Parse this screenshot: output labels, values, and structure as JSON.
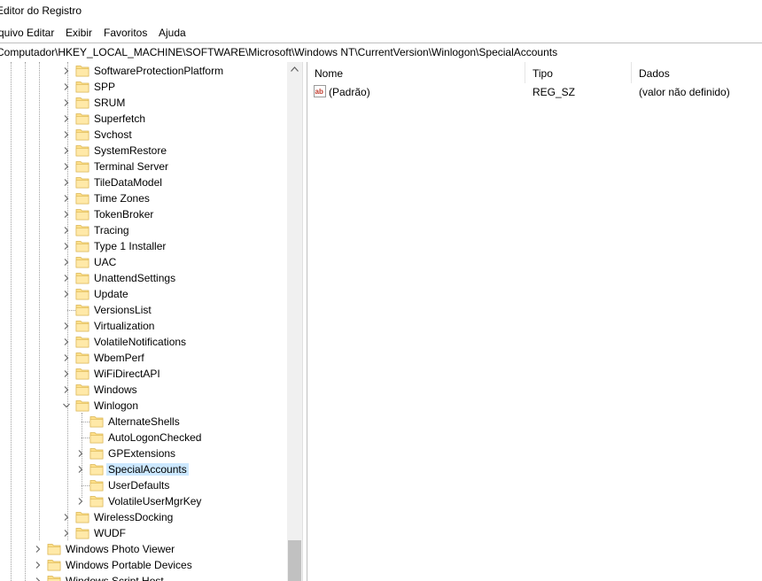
{
  "window": {
    "title": "Editor do Registro"
  },
  "menu": [
    "Arquivo",
    "Editar",
    "Exibir",
    "Favoritos",
    "Ajuda"
  ],
  "address": "Computador\\HKEY_LOCAL_MACHINE\\SOFTWARE\\Microsoft\\Windows NT\\CurrentVersion\\Winlogon\\SpecialAccounts",
  "tree": {
    "items": [
      {
        "label": "SoftwareProtectionPlatform",
        "expandable": true
      },
      {
        "label": "SPP",
        "expandable": true
      },
      {
        "label": "SRUM",
        "expandable": true
      },
      {
        "label": "Superfetch",
        "expandable": true
      },
      {
        "label": "Svchost",
        "expandable": true
      },
      {
        "label": "SystemRestore",
        "expandable": true
      },
      {
        "label": "Terminal Server",
        "expandable": true
      },
      {
        "label": "TileDataModel",
        "expandable": true
      },
      {
        "label": "Time Zones",
        "expandable": true
      },
      {
        "label": "TokenBroker",
        "expandable": true
      },
      {
        "label": "Tracing",
        "expandable": true
      },
      {
        "label": "Type 1 Installer",
        "expandable": true
      },
      {
        "label": "UAC",
        "expandable": true
      },
      {
        "label": "UnattendSettings",
        "expandable": true
      },
      {
        "label": "Update",
        "expandable": true
      },
      {
        "label": "VersionsList",
        "expandable": false
      },
      {
        "label": "Virtualization",
        "expandable": true
      },
      {
        "label": "VolatileNotifications",
        "expandable": true
      },
      {
        "label": "WbemPerf",
        "expandable": true
      },
      {
        "label": "WiFiDirectAPI",
        "expandable": true
      },
      {
        "label": "Windows",
        "expandable": true
      },
      {
        "label": "Winlogon",
        "expanded": true
      },
      {
        "label": "AlternateShells",
        "expandable": false,
        "child": true
      },
      {
        "label": "AutoLogonChecked",
        "expandable": false,
        "child": true
      },
      {
        "label": "GPExtensions",
        "expandable": true,
        "child": true
      },
      {
        "label": "SpecialAccounts",
        "expandable": true,
        "child": true,
        "selected": true
      },
      {
        "label": "UserDefaults",
        "expandable": false,
        "child": true
      },
      {
        "label": "VolatileUserMgrKey",
        "expandable": true,
        "child": true
      },
      {
        "label": "WirelessDocking",
        "expandable": true
      },
      {
        "label": "WUDF",
        "expandable": true
      },
      {
        "label": "Windows Photo Viewer",
        "expandable": true,
        "upper": true
      },
      {
        "label": "Windows Portable Devices",
        "expandable": true,
        "upper": true
      },
      {
        "label": "Windows Script Host",
        "expandable": true,
        "upper": true
      }
    ]
  },
  "list": {
    "columns": [
      "Nome",
      "Tipo",
      "Dados"
    ],
    "rows": [
      {
        "name": "(Padrão)",
        "type": "REG_SZ",
        "data": "(valor não definido)",
        "icon": "string-value-icon"
      }
    ]
  },
  "colors": {
    "folder": "#ffe08a",
    "selection": "#cce8ff",
    "scrollbar": "#f0f0f0"
  }
}
